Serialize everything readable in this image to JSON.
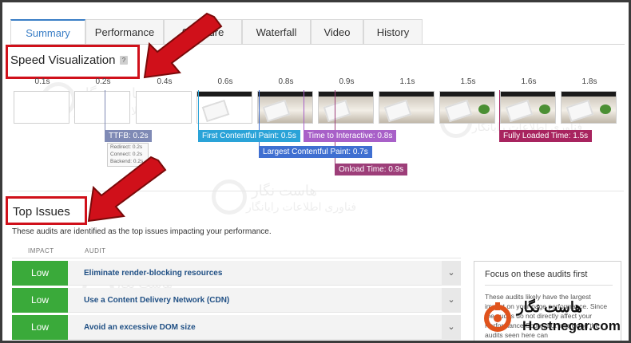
{
  "tabs": [
    {
      "label": "Summary",
      "active": true
    },
    {
      "label": "Performance",
      "active": false
    },
    {
      "label": "Structure",
      "active": false
    },
    {
      "label": "Waterfall",
      "active": false
    },
    {
      "label": "Video",
      "active": false
    },
    {
      "label": "History",
      "active": false
    }
  ],
  "speed_visualization": {
    "title": "Speed Visualization",
    "help_label": "?",
    "times": [
      "0.1s",
      "0.2s",
      "0.4s",
      "0.6s",
      "0.8s",
      "0.9s",
      "1.1s",
      "1.5s",
      "1.6s",
      "1.8s"
    ],
    "markers": {
      "ttfb": "TTFB: 0.2s",
      "fcp": "First Contentful Paint: 0.5s",
      "lcp": "Largest Contentful Paint: 0.7s",
      "tti": "Time to Interactive: 0.8s",
      "onload": "Onload Time: 0.9s",
      "fully_loaded": "Fully Loaded Time: 1.5s"
    },
    "ttfb_details": [
      "Redirect: 0.2s",
      "Connect: 0.2s",
      "Backend: 0.2s"
    ],
    "colors": {
      "ttfb": "#7f8ab5",
      "fcp": "#2aa3d8",
      "lcp": "#3f6fd1",
      "tti": "#a860c8",
      "onload": "#9d3e79",
      "fully_loaded": "#a8245f"
    }
  },
  "top_issues": {
    "title": "Top Issues",
    "description": "These audits are identified as the top issues impacting your performance.",
    "columns": {
      "impact": "IMPACT",
      "audit": "AUDIT"
    },
    "rows": [
      {
        "impact": "Low",
        "audit": "Eliminate render-blocking resources"
      },
      {
        "impact": "Low",
        "audit": "Use a Content Delivery Network (CDN)"
      },
      {
        "impact": "Low",
        "audit": "Avoid an excessive DOM size"
      }
    ],
    "impact_color": "#3aaa3a"
  },
  "focus_panel": {
    "title": "Focus on these audits first",
    "text": "These audits likely have the largest impact on your page performance. Since the audits do not directly affect your Performance Score, but improving the audits seen here can"
  },
  "watermark": {
    "line1": "هاست نگار",
    "line2": "فناوری اطلاعات رایانگار"
  },
  "brand": {
    "name": "Hostnegar.com",
    "name_fa": "هاست نگار"
  },
  "icons": {
    "chevron": "chevron-down-icon",
    "arrow": "red-arrow-icon"
  }
}
